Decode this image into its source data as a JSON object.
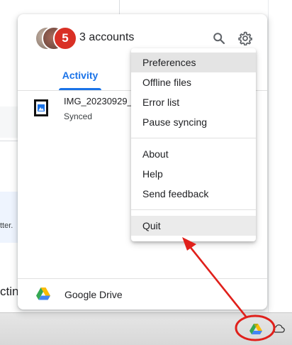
{
  "panel": {
    "avatar_badge": "5",
    "accounts_label": "3 accounts",
    "active_tab": "Activity",
    "file": {
      "name": "IMG_20230929_",
      "status": "Synced"
    },
    "footer_label": "Google Drive"
  },
  "menu": {
    "items_group1": [
      "Preferences",
      "Offline files",
      "Error list",
      "Pause syncing"
    ],
    "items_group2": [
      "About",
      "Help",
      "Send feedback"
    ],
    "items_group3": [
      "Quit"
    ]
  },
  "background": {
    "fragment_small": "tter.",
    "fragment_large": "ctin"
  },
  "colors": {
    "accent_blue": "#1a73e8",
    "badge_red": "#d93025",
    "annotation_red": "#e0201b"
  },
  "icons": [
    "search-icon",
    "gear-icon",
    "google-drive-icon",
    "cloud-icon",
    "image-file-icon"
  ]
}
